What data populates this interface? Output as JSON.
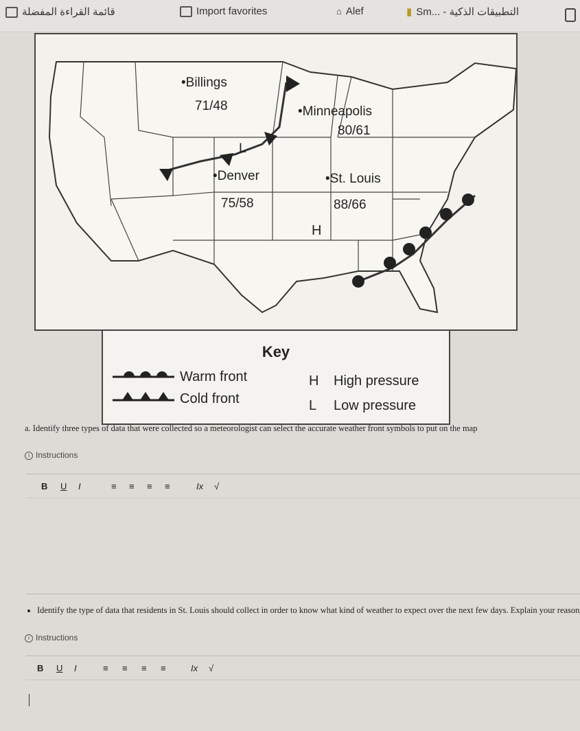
{
  "browser": {
    "bookmarks": [
      {
        "label": "قائمة القراءة المفضلة",
        "icon": "bookmark-folder-icon"
      },
      {
        "label": "Import favorites",
        "icon": "import-icon"
      },
      {
        "label": "Alef",
        "icon": "alef-icon"
      },
      {
        "label": "Sm... - التطبيقات الذكية",
        "icon": "apps-icon"
      }
    ]
  },
  "map": {
    "cities": [
      {
        "name": "•Billings",
        "temps": "71/48"
      },
      {
        "name": "•Minneapolis",
        "temps": "80/61"
      },
      {
        "name": "•Denver",
        "temps": "75/58"
      },
      {
        "name": "•St. Louis",
        "temps": "88/66"
      }
    ],
    "pressure_labels": {
      "low": "L",
      "high": "H"
    }
  },
  "key": {
    "title": "Key",
    "items": [
      {
        "label": "Warm front",
        "symbol": "warm-front-icon"
      },
      {
        "label": "Cold front",
        "symbol": "cold-front-icon"
      },
      {
        "letter": "H",
        "label": "High pressure"
      },
      {
        "letter": "L",
        "label": "Low pressure"
      }
    ]
  },
  "questions": [
    {
      "text": "a. Identify three types of data that were collected so a meteorologist can select the accurate weather front symbols to put on the map",
      "instructions": "Instructions"
    },
    {
      "text": "Identify the type of data that residents in St. Louis should collect in order to know what kind of weather to expect over the next few days. Explain your reasoning",
      "instructions": "Instructions"
    }
  ],
  "editor_toolbar": {
    "bold": "B",
    "underline": "U",
    "italic": "I",
    "align_left": "≡",
    "align_center": "≡",
    "align_right": "≡",
    "justify": "≡",
    "clear_format": "Ix",
    "formula": "√"
  }
}
